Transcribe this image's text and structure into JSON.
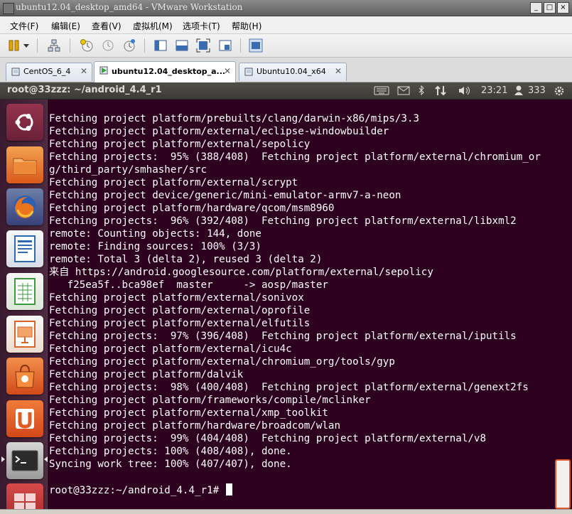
{
  "window": {
    "title": "ubuntu12.04_desktop_amd64 - VMware Workstation"
  },
  "menu": [
    "文件(F)",
    "编辑(E)",
    "查看(V)",
    "虚拟机(M)",
    "选项卡(T)",
    "帮助(H)"
  ],
  "toolbar": {
    "icons": [
      "pause-icon",
      "dropdown-arrow-icon",
      "network-icon",
      "snapshot-icon",
      "revert-snapshot-icon",
      "snapshot-manager-icon",
      "sidebar-icon",
      "console-view-icon",
      "fullscreen-icon",
      "unity-icon",
      "quick-switch-icon"
    ]
  },
  "tabs": [
    {
      "label": "CentOS_6_4",
      "active": false,
      "icon": "vm-icon"
    },
    {
      "label": "ubuntu12.04_desktop_a...",
      "active": true,
      "icon": "vm-running-icon"
    },
    {
      "label": "Ubuntu10.04_x64",
      "active": false,
      "icon": "vm-icon"
    }
  ],
  "panel": {
    "title": "root@33zzz: ~/android_4.4_r1",
    "time": "23:21",
    "user_count": "333",
    "indicators": [
      "keyboard-icon",
      "mail-icon",
      "bluetooth-icon",
      "network-updown-icon",
      "volume-icon",
      "user-icon",
      "gear-icon"
    ]
  },
  "launcher": [
    {
      "name": "dash-home",
      "icon": "ubuntu-logo-icon",
      "color": "#7a2740"
    },
    {
      "name": "files",
      "icon": "folder-icon",
      "color": "#e56b23"
    },
    {
      "name": "firefox",
      "icon": "firefox-icon",
      "color": "#d4521e"
    },
    {
      "name": "libreoffice-writer",
      "icon": "writer-icon",
      "color": "#2d6ab3"
    },
    {
      "name": "libreoffice-calc",
      "icon": "calc-icon",
      "color": "#3b9b3b"
    },
    {
      "name": "libreoffice-impress",
      "icon": "impress-icon",
      "color": "#d9652a"
    },
    {
      "name": "ubuntu-software-center",
      "icon": "software-center-icon",
      "color": "#e6622c"
    },
    {
      "name": "ubuntu-one",
      "icon": "ubuntu-one-icon",
      "color": "#e05b24"
    },
    {
      "name": "terminal",
      "icon": "terminal-icon",
      "color": "#b9b9b9"
    },
    {
      "name": "workspace-switcher",
      "icon": "workspace-icon",
      "color": "#c23a3a"
    }
  ],
  "terminal": {
    "lines": [
      "",
      "Fetching project platform/prebuilts/clang/darwin-x86/mips/3.3",
      "Fetching project platform/external/eclipse-windowbuilder",
      "Fetching project platform/external/sepolicy",
      "Fetching projects:  95% (388/408)  Fetching project platform/external/chromium_or",
      "g/third_party/smhasher/src",
      "Fetching project platform/external/scrypt",
      "Fetching project device/generic/mini-emulator-armv7-a-neon",
      "Fetching project platform/hardware/qcom/msm8960",
      "Fetching projects:  96% (392/408)  Fetching project platform/external/libxml2",
      "remote: Counting objects: 144, done",
      "remote: Finding sources: 100% (3/3)",
      "remote: Total 3 (delta 2), reused 3 (delta 2)",
      "来自 https://android.googlesource.com/platform/external/sepolicy",
      "   f25ea5f..bca98ef  master     -> aosp/master",
      "Fetching project platform/external/sonivox",
      "Fetching project platform/external/oprofile",
      "Fetching project platform/external/elfutils",
      "Fetching projects:  97% (396/408)  Fetching project platform/external/iputils",
      "Fetching project platform/external/icu4c",
      "Fetching project platform/external/chromium_org/tools/gyp",
      "Fetching project platform/dalvik",
      "Fetching projects:  98% (400/408)  Fetching project platform/external/genext2fs",
      "Fetching project platform/frameworks/compile/mclinker",
      "Fetching project platform/external/xmp_toolkit",
      "Fetching project platform/hardware/broadcom/wlan",
      "Fetching projects:  99% (404/408)  Fetching project platform/external/v8",
      "Fetching projects: 100% (408/408), done.",
      "Syncing work tree: 100% (407/407), done.",
      ""
    ],
    "prompt": "root@33zzz:~/android_4.4_r1# "
  },
  "statusbar": {
    "text": ""
  }
}
